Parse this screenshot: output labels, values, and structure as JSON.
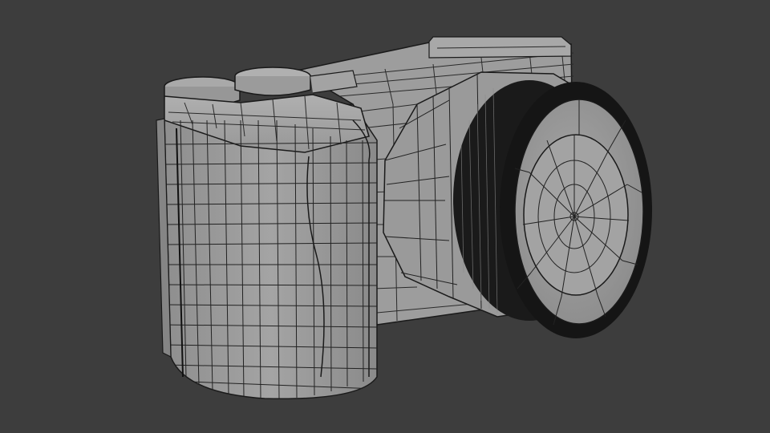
{
  "viewport": {
    "subject": "wireframe-camera-model",
    "background_color": "#3d3d3d",
    "mesh_fill_color": "#9a9a9a",
    "wire_color": "#1a1a1a"
  }
}
